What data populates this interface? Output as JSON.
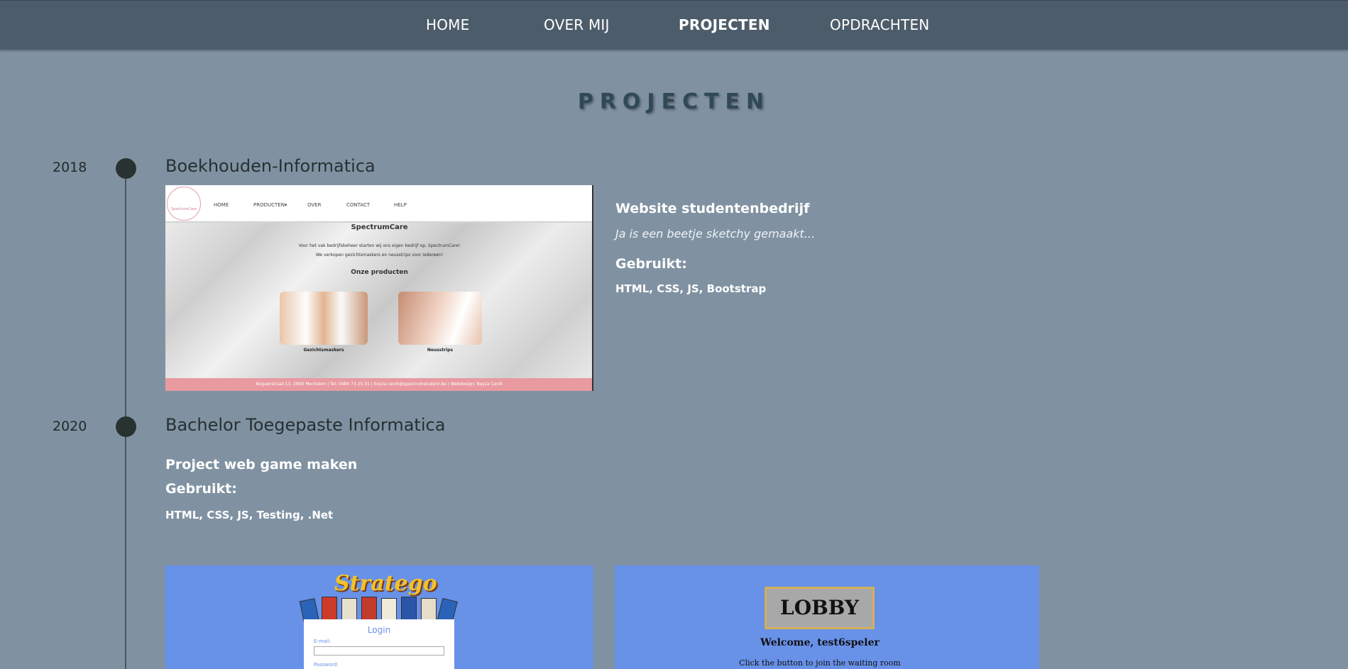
{
  "nav": {
    "items": [
      {
        "label": "HOME",
        "active": false
      },
      {
        "label": "OVER MIJ",
        "active": false
      },
      {
        "label": "PROJECTEN",
        "active": true
      },
      {
        "label": "OPDRACHTEN",
        "active": false
      }
    ]
  },
  "page_title": "PROJECTEN",
  "timeline": [
    {
      "year": "2018",
      "title": "Boekhouden-Informatica",
      "subtitle": "Website studentenbedrijf",
      "note": "Ja is een beetje sketchy gemaakt...",
      "used_label": "Gebruikt:",
      "tech": "HTML, CSS, JS, Bootstrap",
      "screenshot": {
        "brand": "SpectrumCare",
        "nav": [
          "HOME",
          "PRODUCTEN▾",
          "OVER",
          "CONTACT",
          "HELP"
        ],
        "heading": "SpectrumCare",
        "line1": "Voor het vak bedrijfsbeheer starten wij ons eigen bedrijf op, SpectrumCare!",
        "line2": "We verkopen gezichtsmaskers en neusstrips voor iedereen!",
        "products_heading": "Onze producten",
        "product1": "Gezichtsmaskers",
        "product2": "Neusstrips",
        "footer": "Bogaerstraat 13, 2800 Mechelen | Tel: 0484 73 25 31 | beyza.cevik@spectrumstudent.be | Webdesign: Beyza Cevik"
      }
    },
    {
      "year": "2020",
      "title": "Bachelor Toegepaste Informatica",
      "subtitle": "Project web game maken",
      "used_label": "Gebruikt:",
      "tech": "HTML, CSS, JS, Testing, .Net",
      "screenshots": {
        "login": {
          "logo": "Stratego",
          "title": "Login",
          "email_label": "E-mail:",
          "password_label": "Password:"
        },
        "lobby": {
          "button": "LOBBY",
          "welcome": "Welcome, test6speler",
          "text": "Click the button to join the waiting room"
        }
      }
    }
  ],
  "colors": {
    "background": "#8092a2",
    "nav": "#4d5c6a",
    "title": "#2f4a55",
    "game_bg": "#6891e8",
    "footer_pink": "#e89aa0"
  }
}
